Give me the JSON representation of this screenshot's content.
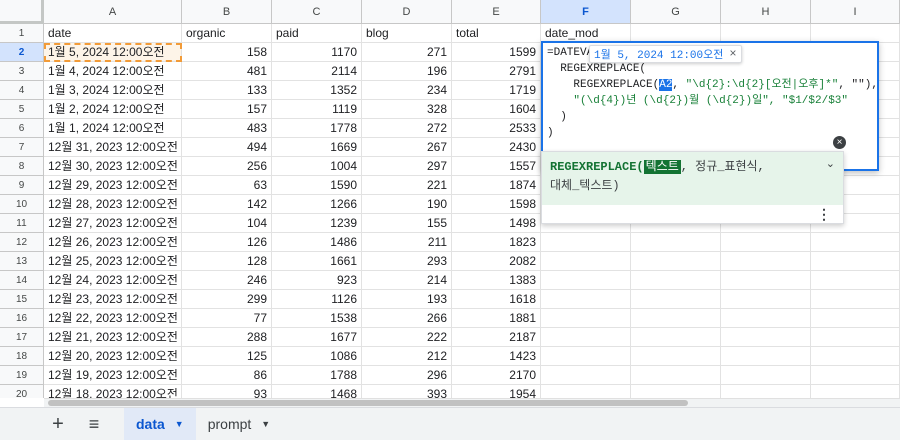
{
  "sheet": {
    "columns": [
      "A",
      "B",
      "C",
      "D",
      "E",
      "F",
      "G",
      "H",
      "I"
    ],
    "selected_column": "F",
    "selected_row": "2",
    "rows": [
      {
        "n": "1",
        "date": "date",
        "organic": "organic",
        "paid": "paid",
        "blog": "blog",
        "total": "total",
        "date_mod": "date_mod"
      },
      {
        "n": "2",
        "date": "1월 5, 2024 12:00오전",
        "organic": "158",
        "paid": "1170",
        "blog": "271",
        "total": "1599",
        "date_mod": ""
      },
      {
        "n": "3",
        "date": "1월 4, 2024 12:00오전",
        "organic": "481",
        "paid": "2114",
        "blog": "196",
        "total": "2791",
        "date_mod": ""
      },
      {
        "n": "4",
        "date": "1월 3, 2024 12:00오전",
        "organic": "133",
        "paid": "1352",
        "blog": "234",
        "total": "1719",
        "date_mod": ""
      },
      {
        "n": "5",
        "date": "1월 2, 2024 12:00오전",
        "organic": "157",
        "paid": "1119",
        "blog": "328",
        "total": "1604",
        "date_mod": ""
      },
      {
        "n": "6",
        "date": "1월 1, 2024 12:00오전",
        "organic": "483",
        "paid": "1778",
        "blog": "272",
        "total": "2533",
        "date_mod": ""
      },
      {
        "n": "7",
        "date": "12월 31, 2023 12:00오전",
        "organic": "494",
        "paid": "1669",
        "blog": "267",
        "total": "2430",
        "date_mod": ""
      },
      {
        "n": "8",
        "date": "12월 30, 2023 12:00오전",
        "organic": "256",
        "paid": "1004",
        "blog": "297",
        "total": "1557",
        "date_mod": ""
      },
      {
        "n": "9",
        "date": "12월 29, 2023 12:00오전",
        "organic": "63",
        "paid": "1590",
        "blog": "221",
        "total": "1874",
        "date_mod": ""
      },
      {
        "n": "10",
        "date": "12월 28, 2023 12:00오전",
        "organic": "142",
        "paid": "1266",
        "blog": "190",
        "total": "1598",
        "date_mod": ""
      },
      {
        "n": "11",
        "date": "12월 27, 2023 12:00오전",
        "organic": "104",
        "paid": "1239",
        "blog": "155",
        "total": "1498",
        "date_mod": ""
      },
      {
        "n": "12",
        "date": "12월 26, 2023 12:00오전",
        "organic": "126",
        "paid": "1486",
        "blog": "211",
        "total": "1823",
        "date_mod": ""
      },
      {
        "n": "13",
        "date": "12월 25, 2023 12:00오전",
        "organic": "128",
        "paid": "1661",
        "blog": "293",
        "total": "2082",
        "date_mod": ""
      },
      {
        "n": "14",
        "date": "12월 24, 2023 12:00오전",
        "organic": "246",
        "paid": "923",
        "blog": "214",
        "total": "1383",
        "date_mod": ""
      },
      {
        "n": "15",
        "date": "12월 23, 2023 12:00오전",
        "organic": "299",
        "paid": "1126",
        "blog": "193",
        "total": "1618",
        "date_mod": ""
      },
      {
        "n": "16",
        "date": "12월 22, 2023 12:00오전",
        "organic": "77",
        "paid": "1538",
        "blog": "266",
        "total": "1881",
        "date_mod": ""
      },
      {
        "n": "17",
        "date": "12월 21, 2023 12:00오전",
        "organic": "288",
        "paid": "1677",
        "blog": "222",
        "total": "2187",
        "date_mod": ""
      },
      {
        "n": "18",
        "date": "12월 20, 2023 12:00오전",
        "organic": "125",
        "paid": "1086",
        "blog": "212",
        "total": "1423",
        "date_mod": ""
      },
      {
        "n": "19",
        "date": "12월 19, 2023 12:00오전",
        "organic": "86",
        "paid": "1788",
        "blog": "296",
        "total": "2170",
        "date_mod": ""
      },
      {
        "n": "20",
        "date": "12월 18, 2023 12:00오전",
        "organic": "93",
        "paid": "1468",
        "blog": "393",
        "total": "1954",
        "date_mod": ""
      }
    ]
  },
  "formula": {
    "line1": "=DATEVA",
    "line2": "  REGEXREPLACE(",
    "line3_pre": "    REGEXREPLACE(",
    "line3_ref": "A2",
    "line3_post": ", ",
    "line3_str": "\"\\d{2}:\\d{2}[오전|오후]*\"",
    "line3_end": ", \"\"),",
    "line4_str": "    \"(\\d{4})년 (\\d{2})월 (\\d{2})일\", \"$1/$2/$3\"",
    "line5": "  )",
    "line6": ")"
  },
  "ref_chip": {
    "value": "1월 5, 2024 12:00오전",
    "close": "×"
  },
  "help": {
    "fname": "REGEXREPLACE(",
    "arg1": "텍스트",
    "rest1": ", 정규_표현식,",
    "line2": "대체_텍스트)",
    "chevron": "⌄",
    "more": "⋮"
  },
  "close_icon": "×",
  "tabs": {
    "add": "+",
    "all": "≡",
    "items": [
      {
        "label": "data",
        "caret": "▼",
        "active": true
      },
      {
        "label": "prompt",
        "caret": "▼",
        "active": false
      }
    ]
  }
}
